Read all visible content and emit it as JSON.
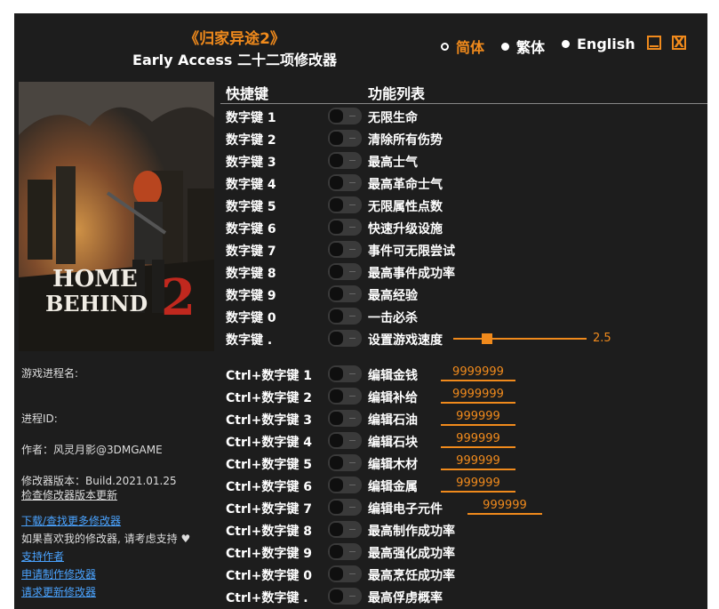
{
  "title": {
    "main": "《归家异途2》",
    "sub": "Early Access 二十二项修改器"
  },
  "languages": [
    {
      "label": "简体",
      "selected": true
    },
    {
      "label": "繁体",
      "selected": false
    },
    {
      "label": "English",
      "selected": false
    }
  ],
  "window_buttons": {
    "close_glyph": "X",
    "minimize_icon": "minimize-icon"
  },
  "header": {
    "hotkey": "快捷键",
    "functions": "功能列表"
  },
  "cover": {
    "logo_line1": "HOME",
    "logo_line2": "BEHIND",
    "logo_number": "2"
  },
  "info": {
    "process_name_label": "游戏进程名:",
    "process_id_label": "进程ID:",
    "author": "作者：风灵月影@3DMGAME",
    "version": "修改器版本：Build.2021.01.25",
    "check_update": "检查修改器版本更新",
    "download_more": "下载/查找更多修改器",
    "support_text": "如果喜欢我的修改器, 请考虑支持",
    "support_author": "支持作者",
    "request_trainer": "申请制作修改器",
    "request_update": "请求更新修改器"
  },
  "rows": [
    {
      "key": "数字键 1",
      "func": "无限生命"
    },
    {
      "key": "数字键 2",
      "func": "清除所有伤势"
    },
    {
      "key": "数字键 3",
      "func": "最高士气"
    },
    {
      "key": "数字键 4",
      "func": "最高革命士气"
    },
    {
      "key": "数字键 5",
      "func": "无限属性点数"
    },
    {
      "key": "数字键 6",
      "func": "快速升级设施"
    },
    {
      "key": "数字键 7",
      "func": "事件可无限尝试"
    },
    {
      "key": "数字键 8",
      "func": "最高事件成功率"
    },
    {
      "key": "数字键 9",
      "func": "最高经验"
    },
    {
      "key": "数字键 0",
      "func": "一击必杀"
    },
    {
      "key": "数字键 .",
      "func": "设置游戏速度",
      "slider_value": "2.5"
    },
    {
      "key": "Ctrl+数字键 1",
      "func": "编辑金钱",
      "value": "9999999"
    },
    {
      "key": "Ctrl+数字键 2",
      "func": "编辑补给",
      "value": "9999999"
    },
    {
      "key": "Ctrl+数字键 3",
      "func": "编辑石油",
      "value": "999999"
    },
    {
      "key": "Ctrl+数字键 4",
      "func": "编辑石块",
      "value": "999999"
    },
    {
      "key": "Ctrl+数字键 5",
      "func": "编辑木材",
      "value": "999999"
    },
    {
      "key": "Ctrl+数字键 6",
      "func": "编辑金属",
      "value": "999999"
    },
    {
      "key": "Ctrl+数字键 7",
      "func": "编辑电子元件",
      "value": "999999"
    },
    {
      "key": "Ctrl+数字键 8",
      "func": "最高制作成功率"
    },
    {
      "key": "Ctrl+数字键 9",
      "func": "最高强化成功率"
    },
    {
      "key": "Ctrl+数字键 0",
      "func": "最高烹饪成功率"
    },
    {
      "key": "Ctrl+数字键 .",
      "func": "最高俘虏概率"
    }
  ],
  "colors": {
    "accent": "#f08a1c",
    "background": "#1d1d1d",
    "link": "#4aa3ff"
  }
}
